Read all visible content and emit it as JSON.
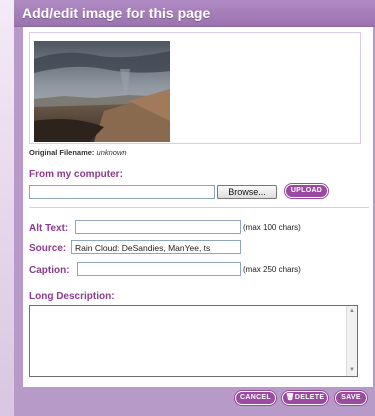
{
  "dialog": {
    "title": "Add/edit image for this page"
  },
  "image": {
    "original_filename_label": "Original Filename:",
    "original_filename_value": "unknown"
  },
  "upload": {
    "section_title": "From my computer:",
    "file_value": "",
    "browse_label": "Browse...",
    "upload_label": "Upload"
  },
  "fields": {
    "alt_text": {
      "label": "Alt Text:",
      "value": "",
      "hint": "(max 100 chars)"
    },
    "source": {
      "label": "Source:",
      "value": "Rain Cloud:  DeSandies, ManYee, ts"
    },
    "caption": {
      "label": "Caption:",
      "value": "",
      "hint": "(max 250 chars)"
    },
    "long_description": {
      "label": "Long Description:",
      "value": ""
    }
  },
  "footer": {
    "cancel_label": "Cancel",
    "delete_label": "Delete",
    "save_label": "Save"
  },
  "colors": {
    "accent": "#8b3a8f",
    "button": "#9a4aa0",
    "frame": "#b89ac9"
  },
  "icons": {
    "delete": "trash-icon",
    "scroll_up": "arrow-up-icon",
    "scroll_down": "arrow-down-icon"
  }
}
